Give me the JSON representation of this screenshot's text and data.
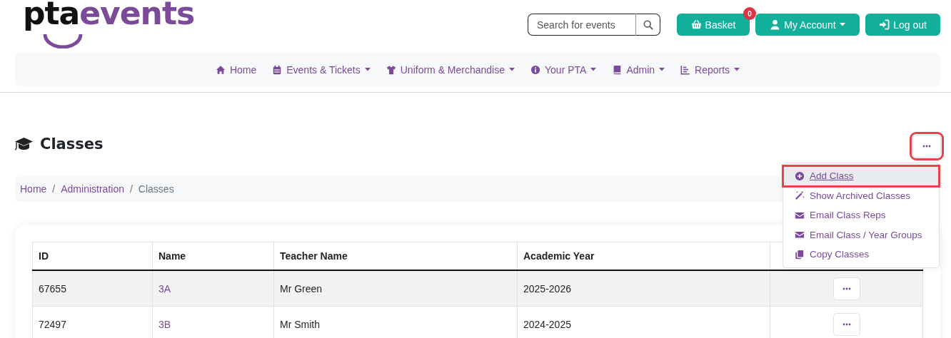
{
  "logo": {
    "dark": "pta",
    "accent": "events"
  },
  "search": {
    "placeholder": "Search for events"
  },
  "header_buttons": [
    {
      "kind": "basket",
      "label": "Basket",
      "badge": "0",
      "dropdown": false
    },
    {
      "kind": "account",
      "label": "My Account",
      "dropdown": true
    },
    {
      "kind": "logout",
      "label": "Log out",
      "dropdown": false
    }
  ],
  "nav": [
    {
      "kind": "home",
      "label": "Home",
      "dropdown": false
    },
    {
      "kind": "calendar",
      "label": "Events & Tickets",
      "dropdown": true
    },
    {
      "kind": "shirt",
      "label": "Uniform & Merchandise",
      "dropdown": true
    },
    {
      "kind": "info",
      "label": "Your PTA",
      "dropdown": true
    },
    {
      "kind": "book",
      "label": "Admin",
      "dropdown": true
    },
    {
      "kind": "chart",
      "label": "Reports",
      "dropdown": true
    }
  ],
  "page_title": "Classes",
  "breadcrumb": {
    "separator": "/",
    "items": [
      {
        "label": "Home",
        "current": false
      },
      {
        "label": "Administration",
        "current": false
      },
      {
        "label": "Classes",
        "current": true
      }
    ]
  },
  "actions_button": {
    "highlighted": true
  },
  "actions_menu": [
    {
      "kind": "plus",
      "label": "Add Class",
      "selected": true,
      "highlighted": true
    },
    {
      "kind": "wand",
      "label": "Show Archived Classes",
      "selected": false,
      "highlighted": false
    },
    {
      "kind": "mail",
      "label": "Email Class Reps",
      "selected": false,
      "highlighted": false
    },
    {
      "kind": "mail",
      "label": "Email Class / Year Groups",
      "selected": false,
      "highlighted": false
    },
    {
      "kind": "copy",
      "label": "Copy Classes",
      "selected": false,
      "highlighted": false
    }
  ],
  "table": {
    "columns": [
      "ID",
      "Name",
      "Teacher Name",
      "Academic Year"
    ],
    "rows": [
      {
        "id": "67655",
        "name": "3A",
        "teacher": "Mr Green",
        "year": "2025-2026"
      },
      {
        "id": "72497",
        "name": "3B",
        "teacher": "Mr Smith",
        "year": "2024-2025"
      }
    ]
  }
}
